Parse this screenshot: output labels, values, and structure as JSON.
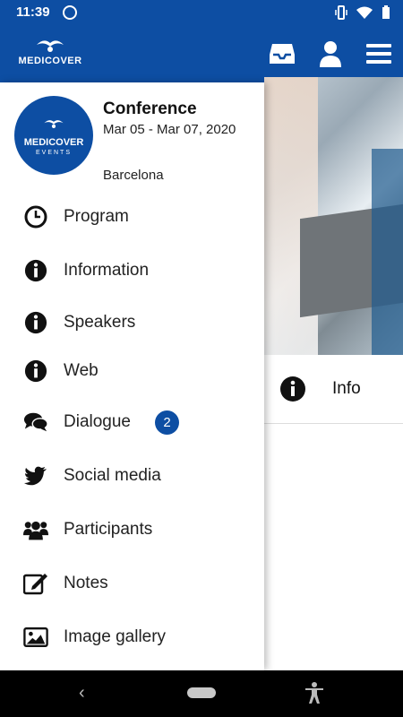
{
  "status_bar": {
    "time": "11:39"
  },
  "app_bar": {
    "logo_text": "MEDICOVER",
    "icons": [
      "inbox-icon",
      "user-icon",
      "menu-icon"
    ]
  },
  "conference": {
    "logo_text": "MEDICOVER",
    "logo_subtext": "EVENTS",
    "title": "Conference",
    "dates": "Mar 05 - Mar 07, 2020",
    "city": "Barcelona"
  },
  "menu": [
    {
      "label": "Program",
      "icon": "clock-icon"
    },
    {
      "label": "Information",
      "icon": "info-icon"
    },
    {
      "label": "Speakers",
      "icon": "info-icon"
    },
    {
      "label": "Web",
      "icon": "info-icon"
    },
    {
      "label": "Dialogue",
      "icon": "chat-icon",
      "badge": "2"
    },
    {
      "label": "Social media",
      "icon": "twitter-icon"
    },
    {
      "label": "Participants",
      "icon": "users-icon"
    },
    {
      "label": "Notes",
      "icon": "edit-icon"
    },
    {
      "label": "Image gallery",
      "icon": "image-icon"
    }
  ],
  "background": {
    "info_label": "Info"
  },
  "colors": {
    "primary": "#0d4ea3"
  }
}
